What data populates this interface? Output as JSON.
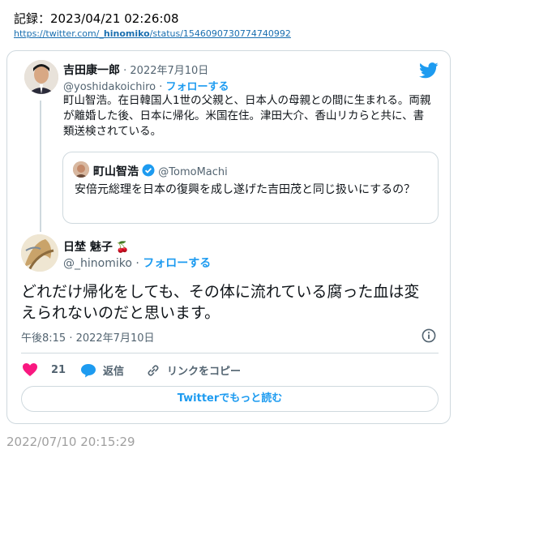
{
  "record": {
    "text": "記録：2023/04/21 02:26:08"
  },
  "source_link": {
    "prefix": "https://twitter.com/",
    "handle": "_hinomiko",
    "suffix": "/status/1546090730774740992"
  },
  "parent_tweet": {
    "name": "吉田康一郎",
    "date": "· 2022年7月10日",
    "handle": "@yoshidakoichiro",
    "sep": " · ",
    "follow": "フォローする",
    "text": "町山智浩。在日韓国人1世の父親と、日本人の母親との間に生まれる。両親が離婚した後、日本に帰化。米国在住。津田大介、香山リカらと共に、書類送検されている。"
  },
  "quoted_tweet": {
    "name": "町山智浩",
    "handle": "@TomoMachi",
    "text": "安倍元総理を日本の復興を成し遂げた吉田茂と同じ扱いにするの？"
  },
  "main_tweet": {
    "name": "日埜 魅子",
    "emoji": "🍒",
    "handle": "@_hinomiko",
    "sep": " · ",
    "follow": "フォローする",
    "text": "どれだけ帰化をしても、その体に流れている腐った血は変えられないのだと思います。",
    "timestamp": "午後8:15 · 2022年7月10日"
  },
  "actions": {
    "likes": "21",
    "reply": "返信",
    "copy_link": "リンクをコピー"
  },
  "read_more": "Twitterでもっと読む",
  "bottom_date": "2022/07/10 20:15:29",
  "colors": {
    "accent": "#1d9bf0",
    "like": "#f91880",
    "muted": "#536471"
  },
  "icons": [
    "twitter-bird-icon",
    "verified-icon",
    "info-icon",
    "heart-icon",
    "reply-icon",
    "link-icon"
  ]
}
